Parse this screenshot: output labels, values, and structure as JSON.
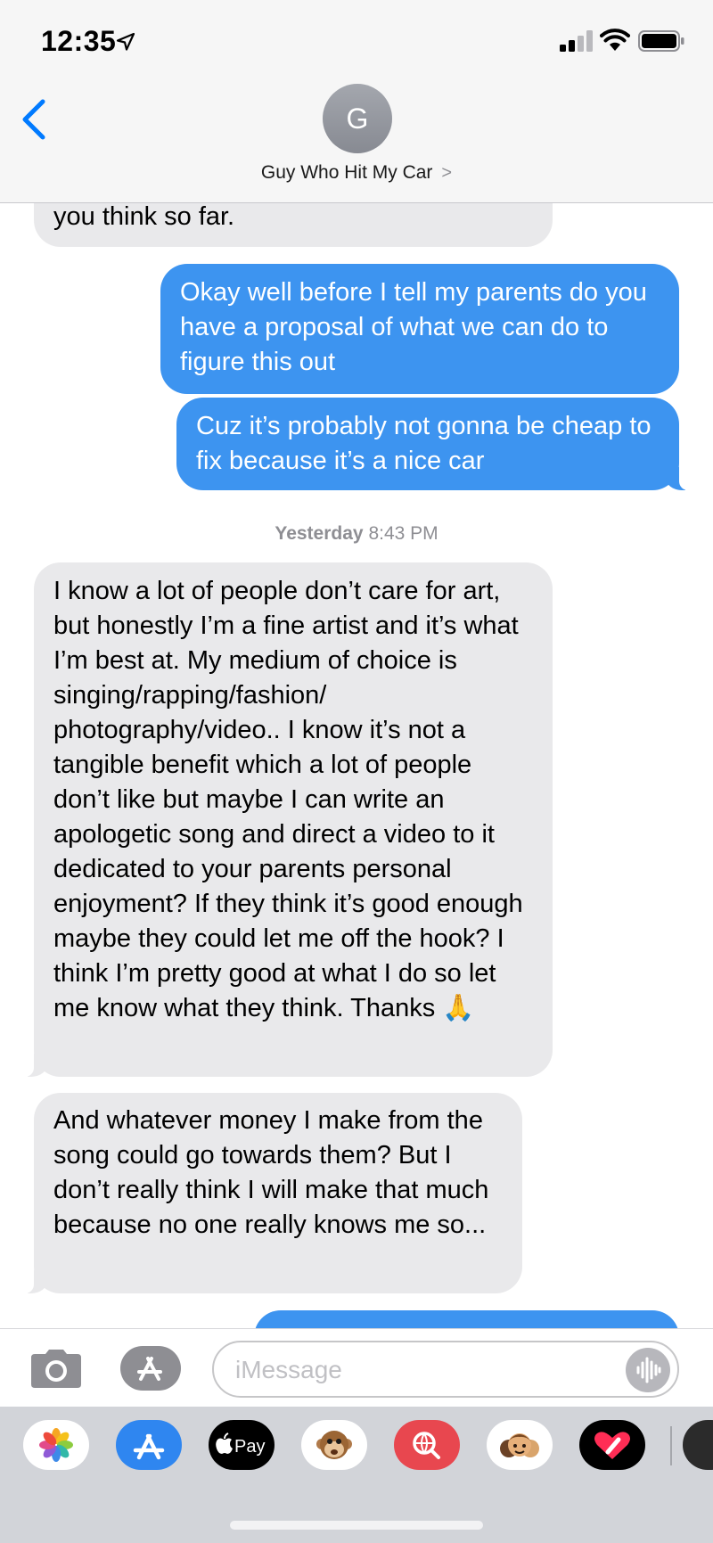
{
  "status_bar": {
    "time": "12:35",
    "icons": [
      "location-arrow-icon",
      "signal-icon",
      "wifi-icon",
      "battery-icon"
    ]
  },
  "header": {
    "avatar_initial": "G",
    "contact_name": "Guy Who Hit My Car",
    "chevron": ">"
  },
  "messages": {
    "partial_incoming": "you think so far.",
    "outgoing_1": "Okay well before I tell my parents do you have a proposal of what we can do to figure this out",
    "outgoing_2": "Cuz it’s probably not gonna be cheap to fix because it’s a nice car",
    "timestamp_day": "Yesterday",
    "timestamp_time": "8:43 PM",
    "incoming_1": "I know a lot of people don’t care for art, but honestly I’m a fine artist and it’s what I’m best at. My medium of choice is singing/rapping/fashion/ photography/video.. I know it’s not a tangible benefit which a lot of people don’t like but maybe I can write an apologetic song and direct a video to it dedicated to your parents personal enjoyment? If they think it’s good enough maybe they could let me off the hook? I think I’m pretty good at what I do so let me know what they think. Thanks 🙏",
    "incoming_2": "And whatever money I make from the song could go towards them? But I don’t really think I will make that much because no one really knows me so..."
  },
  "input": {
    "placeholder": "iMessage"
  },
  "app_drawer": {
    "items": [
      "photos-icon",
      "app-store-icon",
      "apple-pay-icon",
      "animoji-icon",
      "image-search-icon",
      "memoji-icon",
      "digital-touch-icon",
      "music-icon"
    ],
    "apple_pay_label": "Pay",
    "pay_text": "Pay"
  },
  "colors": {
    "outgoing_bubble": "#3d94f0",
    "incoming_bubble": "#e9e9eb",
    "accent": "#007aff"
  }
}
